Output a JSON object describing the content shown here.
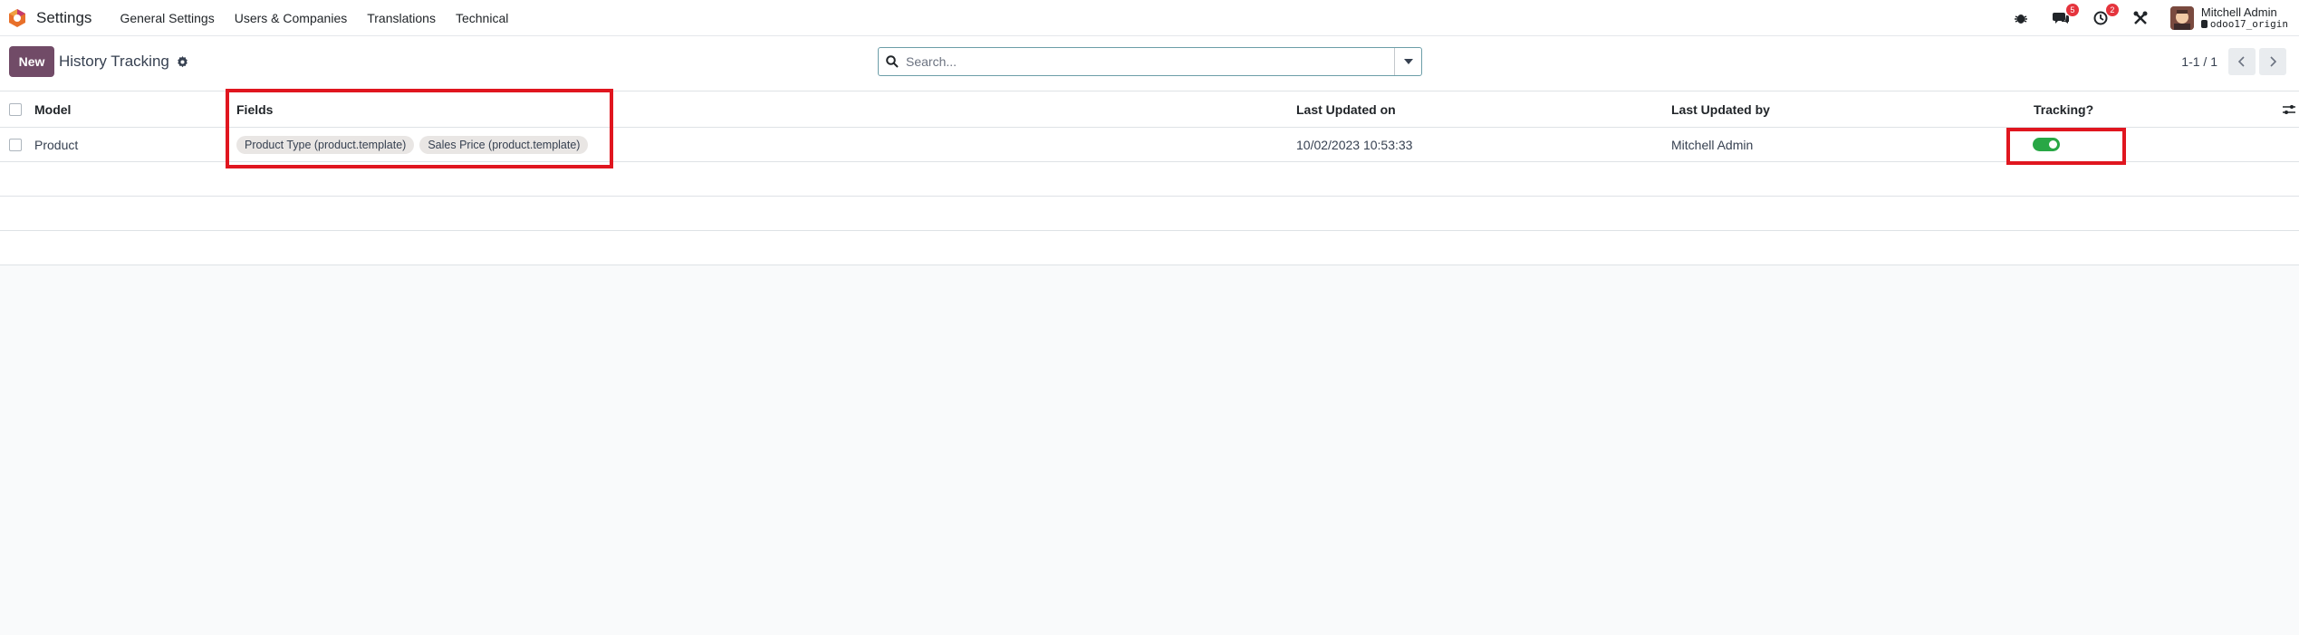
{
  "navbar": {
    "app_title": "Settings",
    "menu": [
      "General Settings",
      "Users & Companies",
      "Translations",
      "Technical"
    ],
    "messages_badge": "5",
    "activities_badge": "2",
    "user_name": "Mitchell Admin",
    "database": "odoo17_origin"
  },
  "control_panel": {
    "new_label": "New",
    "breadcrumb": "History Tracking",
    "search_placeholder": "Search...",
    "pager": "1-1 / 1"
  },
  "table": {
    "columns": [
      "Model",
      "Fields",
      "Last Updated on",
      "Last Updated by",
      "Tracking?"
    ],
    "rows": [
      {
        "model": "Product",
        "fields": [
          "Product Type (product.template)",
          "Sales Price (product.template)"
        ],
        "last_updated_on": "10/02/2023 10:53:33",
        "last_updated_by": "Mitchell Admin",
        "tracking": true
      }
    ]
  },
  "colors": {
    "brand": "#714b67",
    "toggle_on": "#28a745",
    "highlight": "#e0161f"
  }
}
